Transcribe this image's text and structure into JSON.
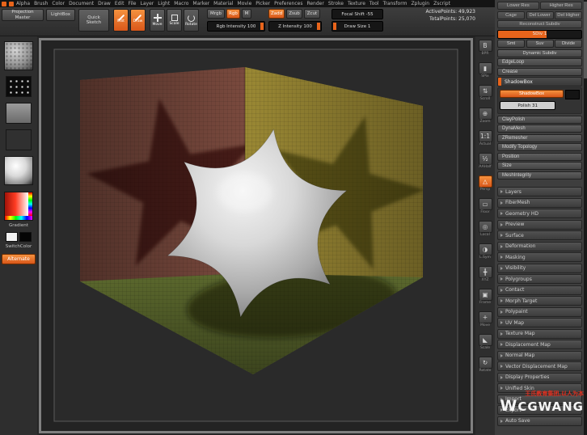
{
  "menubar": {
    "items": [
      "Alpha",
      "Brush",
      "Color",
      "Document",
      "Draw",
      "Edit",
      "File",
      "Layer",
      "Light",
      "Macro",
      "Marker",
      "Material",
      "Movie",
      "Picker",
      "Preferences",
      "Render",
      "Stroke",
      "Texture",
      "Tool",
      "Transform",
      "Zplugin",
      "Zscript"
    ]
  },
  "topshelf": {
    "projection_master": "Projection Master",
    "lightbox": "LightBox",
    "quick_sketch": "Quick Sketch",
    "modes": [
      "Edit",
      "Draw",
      "Move",
      "Scale",
      "Rotate"
    ],
    "mrgb": "Mrgb",
    "rgb": "Rgb",
    "m": "M",
    "rgb_intensity": "Rgb Intensity 100",
    "zadd": "Zadd",
    "zsub": "Zsub",
    "zcut": "Zcut",
    "z_intensity": "Z Intensity 100",
    "focal_shift": "Focal Shift -55",
    "draw_size": "Draw Size 1",
    "active_points": "ActivePoints: 49,923",
    "total_points": "TotalPoints: 25,070"
  },
  "left_shelf": {
    "gradient_label": "Gradient",
    "switch_label": "SwitchColor",
    "alternate": "Alternate"
  },
  "right_shelf": {
    "icons": [
      {
        "label": "BPR",
        "glyph": "B"
      },
      {
        "label": "SPix",
        "glyph": "▮"
      },
      {
        "label": "Scroll",
        "glyph": "⇅"
      },
      {
        "label": "Zoom",
        "glyph": "⊕"
      },
      {
        "label": "Actual",
        "glyph": "1:1"
      },
      {
        "label": "AAHalf",
        "glyph": "½"
      },
      {
        "label": "Persp",
        "glyph": "△"
      },
      {
        "label": "Floor",
        "glyph": "▭"
      },
      {
        "label": "Local",
        "glyph": "◎"
      },
      {
        "label": "L.Sym",
        "glyph": "◑"
      },
      {
        "label": "XYZ",
        "glyph": "╋"
      },
      {
        "label": "Frame",
        "glyph": "▣"
      },
      {
        "label": "Move",
        "glyph": "+"
      },
      {
        "label": "Scale",
        "glyph": "◣"
      },
      {
        "label": "Rotate",
        "glyph": "↻"
      }
    ]
  },
  "tool_panel": {
    "top_rows": [
      [
        "Lower Res",
        "Higher Res"
      ],
      [
        "Cage",
        "Del Lower",
        "Del Higher"
      ],
      [
        "Reconstruct Subdiv"
      ]
    ],
    "sdiv_slider": "SDiv 1",
    "mid_rows": [
      [
        "Smt",
        "Suv",
        "Divide"
      ],
      [
        "Dynamic Subdiv"
      ]
    ],
    "edgeloop": "EdgeLoop",
    "crease": "Crease",
    "shadowbox_header": "ShadowBox",
    "shadowbox_button": "ShadowBox",
    "polish_slider": "Polish 31",
    "buttons": [
      "ClayPolish",
      "DynaMesh",
      "ZRemesher",
      "Modify Topology",
      "Position",
      "Size",
      "MeshIntegrity"
    ],
    "subpalettes": [
      "Layers",
      "FiberMesh",
      "Geometry HD",
      "Preview",
      "Surface",
      "Deformation",
      "Masking",
      "Visibility",
      "Polygroups",
      "Contact",
      "Morph Target",
      "Polypaint",
      "UV Map",
      "Texture Map",
      "Displacement Map",
      "Normal Map",
      "Vector Displacement Map",
      "Display Properties",
      "Unified Skin",
      "Import",
      "Export",
      "Auto Save"
    ]
  },
  "scene": {
    "wall_left": "#7a4a3e",
    "wall_right": "#9a8834",
    "floor": "#5b682d"
  },
  "watermark": {
    "cn": "王氏教育集团,以人为本",
    "logo": "W",
    "brand": "CGWANG"
  }
}
